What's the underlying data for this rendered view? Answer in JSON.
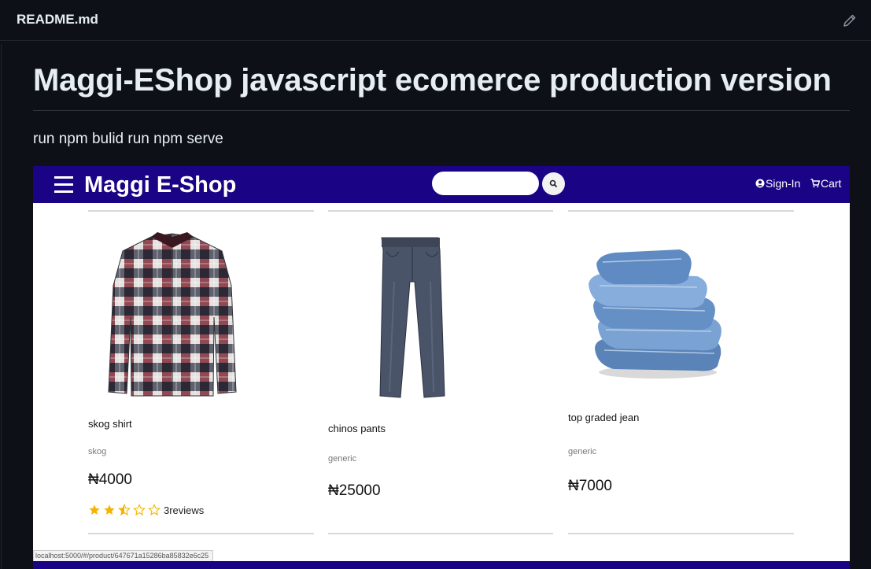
{
  "readme": {
    "filename": "README.md",
    "title": "Maggi-EShop javascript ecomerce production version",
    "paragraph": "run npm bulid run npm serve"
  },
  "shop": {
    "brand": "Maggi E-Shop",
    "search": {
      "placeholder": "",
      "value": ""
    },
    "signin_label": "Sign-In",
    "cart_label": "Cart",
    "nav_color": "#1b0385",
    "products": [
      {
        "name": "skog shirt",
        "brand": "skog",
        "price": "₦4000",
        "image_icon": "plaid-shirt-image",
        "rating": 2.5,
        "reviews_label": "3reviews"
      },
      {
        "name": "chinos pants",
        "brand": "generic",
        "price": "₦25000",
        "image_icon": "pants-image"
      },
      {
        "name": "top graded jean",
        "brand": "generic",
        "price": "₦7000",
        "image_icon": "folded-jeans-image"
      }
    ],
    "status_url": "localhost:5000/#/product/647671a15286ba85832e6c25"
  }
}
